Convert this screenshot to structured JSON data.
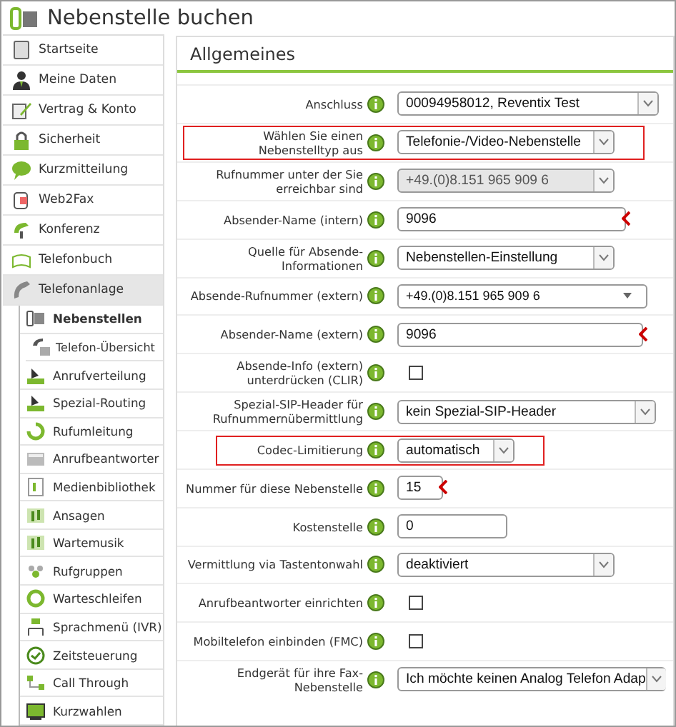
{
  "window": {
    "title": "Nebenstelle buchen"
  },
  "sidebar": {
    "items": [
      {
        "label": "Startseite",
        "selected": false
      },
      {
        "label": "Meine Daten",
        "selected": false
      },
      {
        "label": "Vertrag & Konto",
        "selected": false
      },
      {
        "label": "Sicherheit",
        "selected": false
      },
      {
        "label": "Kurzmitteilung",
        "selected": false
      },
      {
        "label": "Web2Fax",
        "selected": false
      },
      {
        "label": "Konferenz",
        "selected": false
      },
      {
        "label": "Telefonbuch",
        "selected": false
      },
      {
        "label": "Telefonanlage",
        "selected": false,
        "expanded": true,
        "children": [
          {
            "label": "Nebenstellen",
            "selected": true,
            "children": [
              {
                "label": "Telefon-Übersicht",
                "selected": false
              }
            ]
          },
          {
            "label": "Anrufverteilung",
            "selected": false
          },
          {
            "label": "Spezial-Routing",
            "selected": false
          },
          {
            "label": "Rufumleitung",
            "selected": false
          },
          {
            "label": "Anrufbeantworter",
            "selected": false
          },
          {
            "label": "Medienbibliothek",
            "selected": false
          },
          {
            "label": "Ansagen",
            "selected": false
          },
          {
            "label": "Wartemusik",
            "selected": false
          },
          {
            "label": "Rufgruppen",
            "selected": false
          },
          {
            "label": "Warteschleifen",
            "selected": false
          },
          {
            "label": "Sprachmenü (IVR)",
            "selected": false
          },
          {
            "label": "Zeitsteuerung",
            "selected": false
          },
          {
            "label": "Call Through",
            "selected": false
          },
          {
            "label": "Kurzwahlen",
            "selected": false
          }
        ]
      }
    ]
  },
  "panel": {
    "title": "Allgemeines",
    "rows": [
      {
        "label": "Anschluss",
        "kind": "select",
        "value": "00094958012, Reventix Test",
        "highlighted": false,
        "disabled": false
      },
      {
        "label": "Wählen Sie einen Nebenstelltyp aus",
        "kind": "select",
        "value": "Telefonie-/Video-Nebenstelle",
        "highlighted": true,
        "disabled": false
      },
      {
        "label": "Rufnummer unter der Sie erreichbar sind",
        "kind": "select",
        "value": "+49.(0)8.151 965 909 6",
        "highlighted": false,
        "disabled": true
      },
      {
        "label": "Absender-Name (intern)",
        "kind": "input",
        "value": "9096",
        "highlighted": false,
        "required": true
      },
      {
        "label": "Quelle für Absende-Informationen",
        "kind": "select",
        "value": "Nebenstellen-Einstellung",
        "highlighted": false,
        "disabled": false
      },
      {
        "label": "Absende-Rufnummer (extern)",
        "kind": "combo",
        "value": "+49.(0)8.151 965 909 6",
        "highlighted": false
      },
      {
        "label": "Absender-Name (extern)",
        "kind": "input",
        "value": "9096",
        "highlighted": false,
        "required": true
      },
      {
        "label": "Absende-Info (extern) unterdrücken (CLIR)",
        "kind": "checkbox",
        "checked": false,
        "highlighted": false
      },
      {
        "label": "Spezial-SIP-Header für Rufnummernübermittlung",
        "kind": "select",
        "value": "kein Spezial-SIP-Header",
        "highlighted": false,
        "disabled": false
      },
      {
        "label": "Codec-Limitierung",
        "kind": "select",
        "value": "automatisch",
        "highlighted": true,
        "disabled": false
      },
      {
        "label": "Nummer für diese Nebenstelle",
        "kind": "input",
        "value": "15",
        "highlighted": false,
        "required": true
      },
      {
        "label": "Kostenstelle",
        "kind": "input",
        "value": "0",
        "highlighted": false,
        "required": false
      },
      {
        "label": "Vermittlung via Tastentonwahl",
        "kind": "select",
        "value": "deaktiviert",
        "highlighted": false,
        "disabled": false
      },
      {
        "label": "Anrufbeantworter einrichten",
        "kind": "checkbox",
        "checked": false,
        "highlighted": false
      },
      {
        "label": "Mobiltelefon einbinden (FMC)",
        "kind": "checkbox",
        "checked": false,
        "highlighted": false
      },
      {
        "label": "Endgerät für ihre Fax-Nebenstelle",
        "kind": "select",
        "value": "Ich möchte keinen Analog Telefon Adap",
        "highlighted": false,
        "disabled": false
      }
    ]
  }
}
